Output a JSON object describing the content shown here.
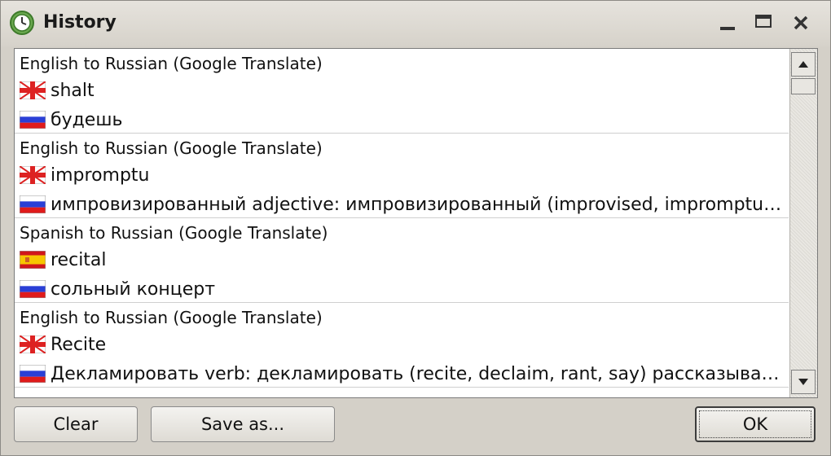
{
  "window": {
    "title": "History",
    "icon": "clock-icon",
    "controls": [
      "minimize-icon",
      "maximize-icon",
      "close-icon"
    ]
  },
  "history": {
    "entries": [
      {
        "direction": "English to Russian (Google Translate)",
        "source": {
          "flag": "uk-flag-icon",
          "text": "shalt"
        },
        "target": {
          "flag": "russia-flag-icon",
          "text": "будешь"
        }
      },
      {
        "direction": "English to Russian (Google Translate)",
        "source": {
          "flag": "uk-flag-icon",
          "text": "impromptu"
        },
        "target": {
          "flag": "russia-flag-icon",
          "text": "импровизированный  adjective: импровизированный (improvised, impromptu, extempore, makeshift, offhand)"
        }
      },
      {
        "direction": "Spanish to Russian (Google Translate)",
        "source": {
          "flag": "spain-flag-icon",
          "text": "recital"
        },
        "target": {
          "flag": "russia-flag-icon",
          "text": "сольный концерт"
        }
      },
      {
        "direction": "English to Russian (Google Translate)",
        "source": {
          "flag": "uk-flag-icon",
          "text": "Recite"
        },
        "target": {
          "flag": "russia-flag-icon",
          "text": "Декламировать  verb: декламировать (recite, declaim, rant, say) рассказывать (tell, narrate)"
        }
      }
    ]
  },
  "buttons": {
    "clear": "Clear",
    "save_as": "Save as...",
    "ok": "OK"
  },
  "colors": {
    "window_bg": "#d4d0c8",
    "list_bg": "#ffffff",
    "row_divider": "#cfcfcf"
  }
}
